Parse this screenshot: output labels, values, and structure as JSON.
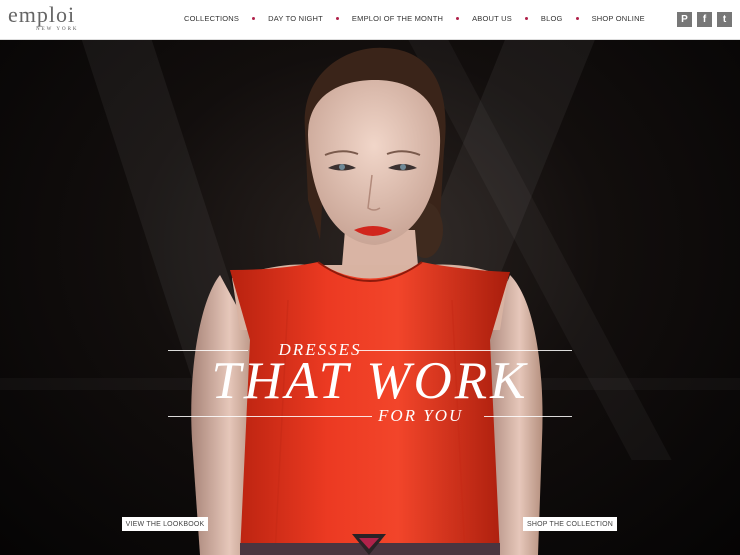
{
  "brand": {
    "name": "emploi",
    "tagline": "NEW YORK"
  },
  "nav": {
    "items": [
      {
        "label": "COLLECTIONS"
      },
      {
        "label": "DAY TO NIGHT"
      },
      {
        "label": "EMPLOI OF THE MONTH"
      },
      {
        "label": "ABOUT US"
      },
      {
        "label": "BLOG"
      },
      {
        "label": "SHOP ONLINE"
      }
    ]
  },
  "social": [
    {
      "icon": "pinterest-icon",
      "glyph": "P"
    },
    {
      "icon": "facebook-icon",
      "glyph": "f"
    },
    {
      "icon": "twitter-icon",
      "glyph": "t"
    }
  ],
  "hero": {
    "headline_top": "DRESSES",
    "headline_main": "THAT WORK",
    "headline_bottom": "FOR YOU",
    "cta_left": "VIEW THE LOOKBOOK",
    "cta_right": "SHOP THE COLLECTION"
  },
  "colors": {
    "accent": "#b0224a",
    "dress": "#e0301f",
    "background": "#0a0807"
  }
}
